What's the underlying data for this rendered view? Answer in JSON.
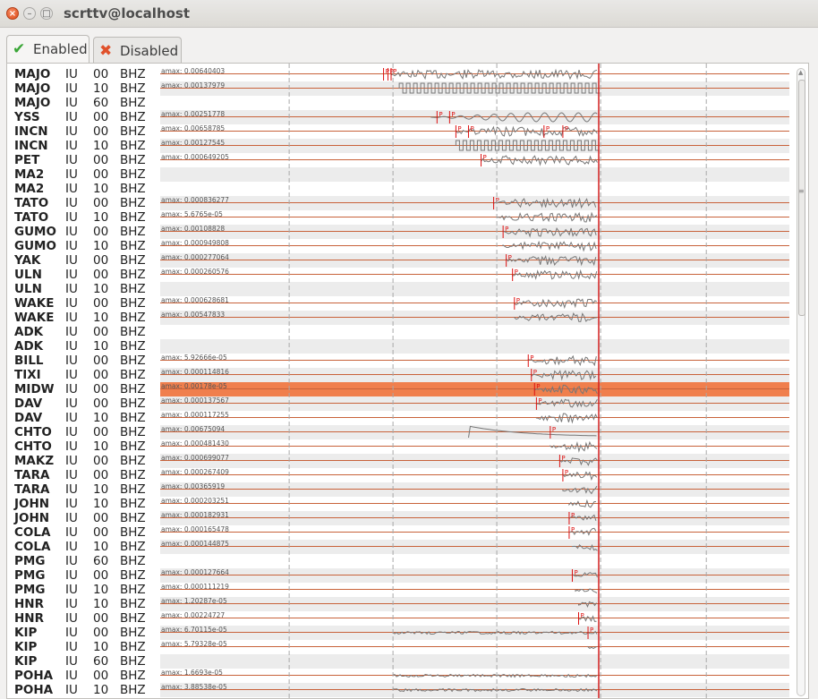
{
  "window": {
    "title": "scrttv@localhost"
  },
  "tabs": [
    {
      "label": "Enabled",
      "icon": "checkmark-icon",
      "color": "#3aa637"
    },
    {
      "label": "Disabled",
      "icon": "cross-icon",
      "color": "#e0512b"
    }
  ],
  "colors": {
    "trace": "#777777",
    "baseline": "#c8623a",
    "pick": "#dd1111",
    "cursor": "#d31f1f",
    "selected": "#f07f4d",
    "grid": "#a8a8a8"
  },
  "pick_label": "P",
  "rows": [
    {
      "sta": "MAJO",
      "net": "IU",
      "loc": "00",
      "cha": "BHZ",
      "amax": "amax: 0.00640403",
      "trace": "tail",
      "onset": 0.367,
      "picks": [
        0.355,
        0.362,
        0.367
      ]
    },
    {
      "sta": "MAJO",
      "net": "IU",
      "loc": "10",
      "cha": "BHZ",
      "amax": "amax: 0.00137979",
      "trace": "square",
      "onset": 0.38,
      "picks": []
    },
    {
      "sta": "MAJO",
      "net": "IU",
      "loc": "60",
      "cha": "BHZ",
      "amax": "",
      "trace": "none",
      "onset": 0,
      "picks": []
    },
    {
      "sta": "YSS",
      "net": "IU",
      "loc": "00",
      "cha": "BHZ",
      "amax": "amax: 0.00251778",
      "trace": "sine",
      "onset": 0.43,
      "picks": [
        0.44,
        0.46
      ]
    },
    {
      "sta": "INCN",
      "net": "IU",
      "loc": "00",
      "cha": "BHZ",
      "amax": "amax: 0.00658785",
      "trace": "tail",
      "onset": 0.47,
      "picks": [
        0.47,
        0.49,
        0.61,
        0.64
      ]
    },
    {
      "sta": "INCN",
      "net": "IU",
      "loc": "10",
      "cha": "BHZ",
      "amax": "amax: 0.00127545",
      "trace": "square",
      "onset": 0.47,
      "picks": []
    },
    {
      "sta": "PET",
      "net": "IU",
      "loc": "00",
      "cha": "BHZ",
      "amax": "amax: 0.000649205",
      "trace": "tail",
      "onset": 0.51,
      "picks": [
        0.51
      ]
    },
    {
      "sta": "MA2",
      "net": "IU",
      "loc": "00",
      "cha": "BHZ",
      "amax": "",
      "trace": "none",
      "onset": 0,
      "picks": []
    },
    {
      "sta": "MA2",
      "net": "IU",
      "loc": "10",
      "cha": "BHZ",
      "amax": "",
      "trace": "none",
      "onset": 0,
      "picks": []
    },
    {
      "sta": "TATO",
      "net": "IU",
      "loc": "00",
      "cha": "BHZ",
      "amax": "amax: 0.000836277",
      "trace": "tail",
      "onset": 0.53,
      "picks": [
        0.53
      ]
    },
    {
      "sta": "TATO",
      "net": "IU",
      "loc": "10",
      "cha": "BHZ",
      "amax": "amax: 5.6765e-05",
      "trace": "tail",
      "onset": 0.535,
      "picks": []
    },
    {
      "sta": "GUMO",
      "net": "IU",
      "loc": "00",
      "cha": "BHZ",
      "amax": "amax: 0.00108828",
      "trace": "tail",
      "onset": 0.545,
      "picks": [
        0.545
      ]
    },
    {
      "sta": "GUMO",
      "net": "IU",
      "loc": "10",
      "cha": "BHZ",
      "amax": "amax: 0.000949808",
      "trace": "tail",
      "onset": 0.545,
      "picks": []
    },
    {
      "sta": "YAK",
      "net": "IU",
      "loc": "00",
      "cha": "BHZ",
      "amax": "amax: 0.000277064",
      "trace": "tail",
      "onset": 0.55,
      "picks": [
        0.55
      ]
    },
    {
      "sta": "ULN",
      "net": "IU",
      "loc": "00",
      "cha": "BHZ",
      "amax": "amax: 0.000260576",
      "trace": "tail",
      "onset": 0.56,
      "picks": [
        0.56
      ]
    },
    {
      "sta": "ULN",
      "net": "IU",
      "loc": "10",
      "cha": "BHZ",
      "amax": "",
      "trace": "none",
      "onset": 0,
      "picks": []
    },
    {
      "sta": "WAKE",
      "net": "IU",
      "loc": "00",
      "cha": "BHZ",
      "amax": "amax: 0.000628681",
      "trace": "tail",
      "onset": 0.563,
      "picks": [
        0.563
      ]
    },
    {
      "sta": "WAKE",
      "net": "IU",
      "loc": "10",
      "cha": "BHZ",
      "amax": "amax: 0.00547833",
      "trace": "tail",
      "onset": 0.563,
      "picks": []
    },
    {
      "sta": "ADK",
      "net": "IU",
      "loc": "00",
      "cha": "BHZ",
      "amax": "",
      "trace": "none",
      "onset": 0,
      "picks": []
    },
    {
      "sta": "ADK",
      "net": "IU",
      "loc": "10",
      "cha": "BHZ",
      "amax": "",
      "trace": "none",
      "onset": 0,
      "picks": []
    },
    {
      "sta": "BILL",
      "net": "IU",
      "loc": "00",
      "cha": "BHZ",
      "amax": "amax: 5.92666e-05",
      "trace": "tail",
      "onset": 0.585,
      "picks": [
        0.585
      ]
    },
    {
      "sta": "TIXI",
      "net": "IU",
      "loc": "00",
      "cha": "BHZ",
      "amax": "amax: 0.000114816",
      "trace": "tail",
      "onset": 0.59,
      "picks": [
        0.59
      ]
    },
    {
      "sta": "MIDW",
      "net": "IU",
      "loc": "00",
      "cha": "BHZ",
      "amax": "amax: 0.00178e-05",
      "trace": "tail",
      "onset": 0.595,
      "picks": [
        0.595
      ],
      "selected": true
    },
    {
      "sta": "DAV",
      "net": "IU",
      "loc": "00",
      "cha": "BHZ",
      "amax": "amax: 0.000137567",
      "trace": "tail",
      "onset": 0.598,
      "picks": [
        0.598
      ]
    },
    {
      "sta": "DAV",
      "net": "IU",
      "loc": "10",
      "cha": "BHZ",
      "amax": "amax: 0.000117255",
      "trace": "tail",
      "onset": 0.598,
      "picks": []
    },
    {
      "sta": "CHTO",
      "net": "IU",
      "loc": "00",
      "cha": "BHZ",
      "amax": "amax: 0.00675094",
      "trace": "decay",
      "onset": 0.49,
      "picks": [
        0.62
      ]
    },
    {
      "sta": "CHTO",
      "net": "IU",
      "loc": "10",
      "cha": "BHZ",
      "amax": "amax: 0.000481430",
      "trace": "tail",
      "onset": 0.62,
      "picks": []
    },
    {
      "sta": "MAKZ",
      "net": "IU",
      "loc": "00",
      "cha": "BHZ",
      "amax": "amax: 0.000699077",
      "trace": "tail",
      "onset": 0.635,
      "picks": [
        0.635
      ]
    },
    {
      "sta": "TARA",
      "net": "IU",
      "loc": "00",
      "cha": "BHZ",
      "amax": "amax: 0.000267409",
      "trace": "tail",
      "onset": 0.64,
      "picks": [
        0.64
      ]
    },
    {
      "sta": "TARA",
      "net": "IU",
      "loc": "10",
      "cha": "BHZ",
      "amax": "amax: 0.00365919",
      "trace": "tail",
      "onset": 0.64,
      "picks": []
    },
    {
      "sta": "JOHN",
      "net": "IU",
      "loc": "10",
      "cha": "BHZ",
      "amax": "amax: 0.000203251",
      "trace": "tail",
      "onset": 0.65,
      "picks": []
    },
    {
      "sta": "JOHN",
      "net": "IU",
      "loc": "00",
      "cha": "BHZ",
      "amax": "amax: 0.000182931",
      "trace": "tail",
      "onset": 0.65,
      "picks": [
        0.65
      ]
    },
    {
      "sta": "COLA",
      "net": "IU",
      "loc": "00",
      "cha": "BHZ",
      "amax": "amax: 0.000165478",
      "trace": "tail",
      "onset": 0.65,
      "picks": [
        0.65
      ]
    },
    {
      "sta": "COLA",
      "net": "IU",
      "loc": "10",
      "cha": "BHZ",
      "amax": "amax: 0.000144875",
      "trace": "tail",
      "onset": 0.655,
      "picks": []
    },
    {
      "sta": "PMG",
      "net": "IU",
      "loc": "60",
      "cha": "BHZ",
      "amax": "",
      "trace": "none",
      "onset": 0,
      "picks": []
    },
    {
      "sta": "PMG",
      "net": "IU",
      "loc": "00",
      "cha": "BHZ",
      "amax": "amax: 0.000127664",
      "trace": "tail",
      "onset": 0.655,
      "picks": [
        0.655
      ]
    },
    {
      "sta": "PMG",
      "net": "IU",
      "loc": "10",
      "cha": "BHZ",
      "amax": "amax: 0.000111219",
      "trace": "tail",
      "onset": 0.66,
      "picks": []
    },
    {
      "sta": "HNR",
      "net": "IU",
      "loc": "10",
      "cha": "BHZ",
      "amax": "amax: 1.20287e-05",
      "trace": "tail",
      "onset": 0.665,
      "picks": []
    },
    {
      "sta": "HNR",
      "net": "IU",
      "loc": "00",
      "cha": "BHZ",
      "amax": "amax: 0.00224727",
      "trace": "tail",
      "onset": 0.665,
      "picks": [
        0.665
      ]
    },
    {
      "sta": "KIP",
      "net": "IU",
      "loc": "00",
      "cha": "BHZ",
      "amax": "amax: 6.70115e-05",
      "trace": "noise",
      "onset": 0.37,
      "picks": [
        0.68
      ]
    },
    {
      "sta": "KIP",
      "net": "IU",
      "loc": "10",
      "cha": "BHZ",
      "amax": "amax: 5.79328e-05",
      "trace": "tail",
      "onset": 0.68,
      "picks": []
    },
    {
      "sta": "KIP",
      "net": "IU",
      "loc": "60",
      "cha": "BHZ",
      "amax": "",
      "trace": "none",
      "onset": 0,
      "picks": []
    },
    {
      "sta": "POHA",
      "net": "IU",
      "loc": "00",
      "cha": "BHZ",
      "amax": "amax: 1.6693e-05",
      "trace": "noise",
      "onset": 0.37,
      "picks": []
    },
    {
      "sta": "POHA",
      "net": "IU",
      "loc": "10",
      "cha": "BHZ",
      "amax": "amax: 3.88538e-05",
      "trace": "noise",
      "onset": 0.37,
      "picks": []
    }
  ]
}
